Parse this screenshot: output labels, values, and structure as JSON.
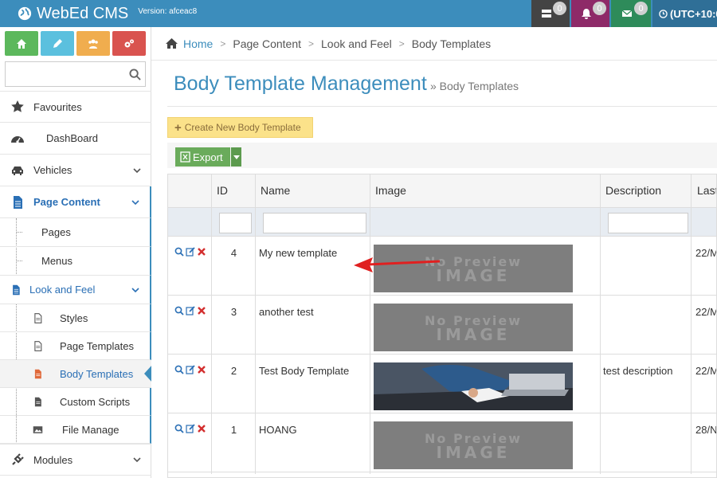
{
  "header": {
    "brand": "WebEd CMS",
    "version": "Version: afceac8",
    "notifications": [
      {
        "icon": "server-icon",
        "count": "0",
        "color": "#444444"
      },
      {
        "icon": "bell-icon",
        "count": "0",
        "color": "#8e2a68"
      },
      {
        "icon": "envelope-icon",
        "count": "0",
        "color": "#2e8b5a"
      }
    ],
    "timezone": "(UTC+10:0"
  },
  "sidebar": {
    "quick_buttons": [
      {
        "icon": "home-icon",
        "color": "#5cb85c"
      },
      {
        "icon": "pencil-icon",
        "color": "#5bc0de"
      },
      {
        "icon": "users-icon",
        "color": "#f0ad4e"
      },
      {
        "icon": "cogs-icon",
        "color": "#d9534f"
      }
    ],
    "search_placeholder": "",
    "items": [
      {
        "label": "Favourites",
        "icon": "star-icon"
      },
      {
        "label": "DashBoard",
        "icon": "dashboard-icon"
      },
      {
        "label": "Vehicles",
        "icon": "car-icon"
      },
      {
        "label": "Page Content",
        "icon": "file-icon"
      },
      {
        "label": "Pages"
      },
      {
        "label": "Menus"
      },
      {
        "label": "Look and Feel",
        "icon": "file-icon"
      },
      {
        "label": "Styles",
        "icon": "doc-icon"
      },
      {
        "label": "Page Templates",
        "icon": "doc-icon"
      },
      {
        "label": "Body Templates",
        "icon": "doc-icon"
      },
      {
        "label": "Custom Scripts",
        "icon": "doc-icon"
      },
      {
        "label": "File Manage",
        "icon": "image-icon"
      },
      {
        "label": "Modules",
        "icon": "plug-icon"
      }
    ]
  },
  "breadcrumb": [
    "Home",
    "Page Content",
    "Look and Feel",
    "Body Templates"
  ],
  "page": {
    "title": "Body Template Management",
    "subtitle": "» Body Templates"
  },
  "actions": {
    "create_label": "Create New Body Template",
    "export_label": "Export"
  },
  "table": {
    "columns": [
      "",
      "ID",
      "Name",
      "Image",
      "Description",
      "Last"
    ],
    "rows": [
      {
        "id": "4",
        "name": "My new template",
        "image": "no-preview",
        "description": "",
        "last": "22/M"
      },
      {
        "id": "3",
        "name": "another test",
        "image": "no-preview",
        "description": "",
        "last": "22/M"
      },
      {
        "id": "2",
        "name": "Test Body Template",
        "image": "photo",
        "description": "test description",
        "last": "22/M"
      },
      {
        "id": "1",
        "name": "HOANG",
        "image": "no-preview",
        "description": "",
        "last": "28/N"
      }
    ],
    "no_preview_text": [
      "No Preview",
      "IMAGE"
    ]
  },
  "colors": {
    "header": "#3c8dbc",
    "accent": "#3c8dbc",
    "active_text": "#2a6fb5",
    "arrow": "#e02020"
  }
}
